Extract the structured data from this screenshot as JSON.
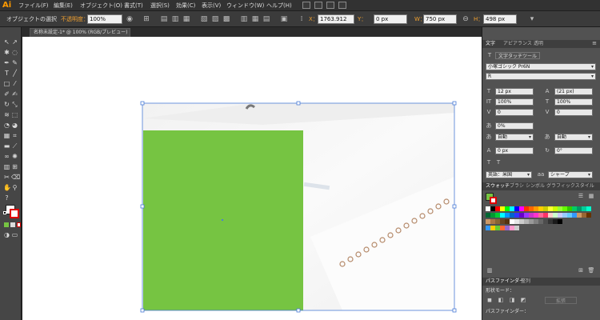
{
  "menubar": {
    "app_logo": "Ai",
    "items": [
      "ファイル(F)",
      "編集(E)",
      "オブジェクト(O)",
      "書式(T)",
      "選択(S)",
      "効果(C)",
      "表示(V)",
      "ウィンドウ(W)",
      "ヘルプ(H)"
    ]
  },
  "controlbar": {
    "object_label": "オブジェクトの選択",
    "opacity_label": "不透明度：",
    "opacity_value": "100%",
    "x_label": "X：",
    "x_value": "1763.912",
    "y_label": "Y：",
    "y_value": "0 px",
    "w_label": "W：",
    "w_value": "750 px",
    "h_label": "H：",
    "h_value": "498 px"
  },
  "document": {
    "tab_title": "名称未設定-1* @ 100% (RGB/プレビュー)"
  },
  "character_panel": {
    "tabs": [
      "文字",
      "アピアランス",
      "透明"
    ],
    "touch_tool": "文字タッチツール",
    "font_family": "小塚ゴシック Pr6N",
    "font_style": "R",
    "font_size": "12 px",
    "leading": "(21 px)",
    "vertical_scale": "100%",
    "horizontal_scale": "100%",
    "kerning": "0",
    "tracking": "0",
    "tsume": "0%",
    "mojikumi_left": "自動",
    "mojikumi_right": "自動",
    "baseline_shift": "0 px",
    "rotation": "0°",
    "language": "英語：米国",
    "antialias": "シャープ"
  },
  "swatches_panel": {
    "tabs": [
      "スウォッチ",
      "ブラシ",
      "シンボル",
      "グラフィックスタイル"
    ],
    "colors_row1": [
      "#ffffff",
      "#000000",
      "#ff0000",
      "#ffff00",
      "#00ff00",
      "#00ffff",
      "#0000ff",
      "#ff00ff",
      "#ff3300",
      "#ff6600",
      "#ff9900",
      "#ffcc00",
      "#cccc00",
      "#ffff33",
      "#ccff00",
      "#99ff33",
      "#66ff00",
      "#33cc00",
      "#00cc66",
      "#009966",
      "#00cc99",
      "#00ffcc"
    ],
    "colors_row2": [
      "#006633",
      "#009933",
      "#00cc33",
      "#00ffff",
      "#0099ff",
      "#0066cc",
      "#3333ff",
      "#6600cc",
      "#9933ff",
      "#cc33cc",
      "#ff33cc",
      "#ff6699",
      "#ff3366",
      "#ffcccc",
      "#ccffcc",
      "#ccccff",
      "#99ccff",
      "#66ccff",
      "#3399ff",
      "#cc9966",
      "#996633",
      "#663300"
    ],
    "colors_row3": [
      "#cc9966",
      "#aa7744",
      "#886633",
      "#664422",
      "#553311",
      "#ffffff",
      "#e6e6e6",
      "#cccccc",
      "#b3b3b3",
      "#999999",
      "#808080",
      "#666666",
      "#4d4d4d",
      "#333333",
      "#1a1a1a",
      "#000000"
    ],
    "colors_row4": [
      "#3399ff",
      "#ffcc00",
      "#66cc33",
      "#ff6633",
      "#9966cc",
      "#ff99cc",
      "#cccccc"
    ]
  },
  "pathfinder_panel": {
    "tabs": [
      "パスファインダー",
      "整列"
    ],
    "shape_modes_label": "形状モード：",
    "expand_label": "拡張",
    "pathfinders_label": "パスファインダー："
  },
  "artwork": {
    "green_rect_color": "#76c442",
    "selection_color": "#4a7bd6"
  }
}
